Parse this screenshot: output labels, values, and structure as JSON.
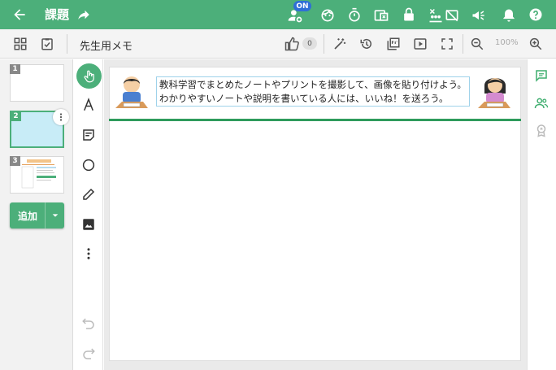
{
  "header": {
    "title": "課題",
    "on_badge": "ON",
    "bar_color": "#4caf7a",
    "icons": [
      "back-arrow-icon",
      "share-icon",
      "student-settings-icon",
      "face-icon",
      "timer-icon",
      "screen-share-icon",
      "lock-icon",
      "group-off-icon",
      "cast-off-icon",
      "announce-icon",
      "bell-icon",
      "help-icon"
    ]
  },
  "toolbar": {
    "memo_label": "先生用メモ",
    "like_count": "0",
    "zoom_level": "100%"
  },
  "thumbnails": {
    "pages": [
      "1",
      "2",
      "3"
    ],
    "selected": "2",
    "add_label": "追加"
  },
  "tools": [
    "hand-pointer-icon",
    "text-tool-icon",
    "sticky-note-icon",
    "shape-circle-icon",
    "pen-icon",
    "image-icon",
    "more-vert-icon",
    "undo-icon",
    "redo-icon"
  ],
  "sheet": {
    "instruction_line1": "教科学習でまとめたノートやプリントを撮影して、画像を貼り付けよう。",
    "instruction_line2": "わかりやすいノートや説明を書いている人には、いいね！を送ろう。",
    "line_color": "#2e9b5c"
  },
  "right_panel": [
    "comment-icon",
    "people-icon",
    "badge-icon"
  ]
}
